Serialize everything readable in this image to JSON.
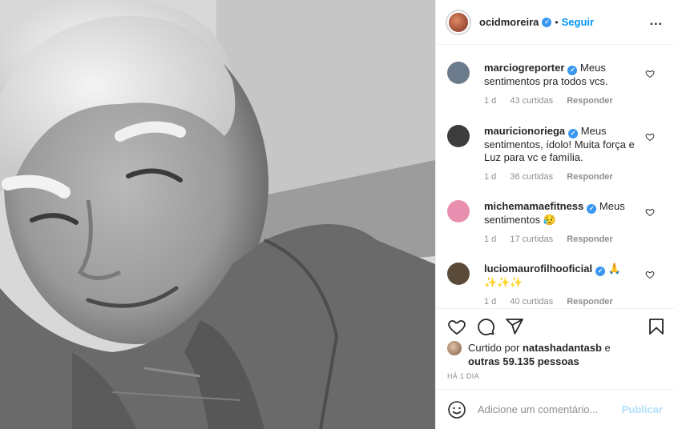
{
  "post": {
    "author": "ocidmoreira",
    "follow_label": "Seguir",
    "separator": "•",
    "more_label": "...",
    "photo_icon": "portrait-photo"
  },
  "comments": [
    {
      "user": "marciogreporter",
      "verified": true,
      "text": "Meus sentimentos pra todos vcs.",
      "time": "1 d",
      "likes": "43 curtidas",
      "reply": "Responder",
      "avatar_color": "#6b7b8c"
    },
    {
      "user": "mauricionoriega",
      "verified": true,
      "text": "Meus sentimentos, ídolo! Muita força e Luz para vc e família.",
      "time": "1 d",
      "likes": "36 curtidas",
      "reply": "Responder",
      "avatar_color": "#3c3c3c"
    },
    {
      "user": "michemamaefitness",
      "verified": true,
      "text": "Meus sentimentos 😥",
      "time": "1 d",
      "likes": "17 curtidas",
      "reply": "Responder",
      "avatar_color": "#e88fb0"
    },
    {
      "user": "luciomaurofilhooficial",
      "verified": true,
      "text": "🙏 ✨✨✨",
      "time": "1 d",
      "likes": "40 curtidas",
      "reply": "Responder",
      "avatar_color": "#5a4a3a"
    }
  ],
  "likes": {
    "prefix": "Curtido por",
    "user": "natashadantasb",
    "middle": "e",
    "others": "outras 59.135 pessoas"
  },
  "timestamp": "HÁ 1 DIA",
  "add_comment": {
    "placeholder": "Adicione um comentário...",
    "publish_label": "Publicar"
  },
  "colors": {
    "accent": "#0095f6",
    "verified": "#3897f0",
    "muted": "#8e8e8e",
    "publish_disabled": "#b2dffc"
  }
}
